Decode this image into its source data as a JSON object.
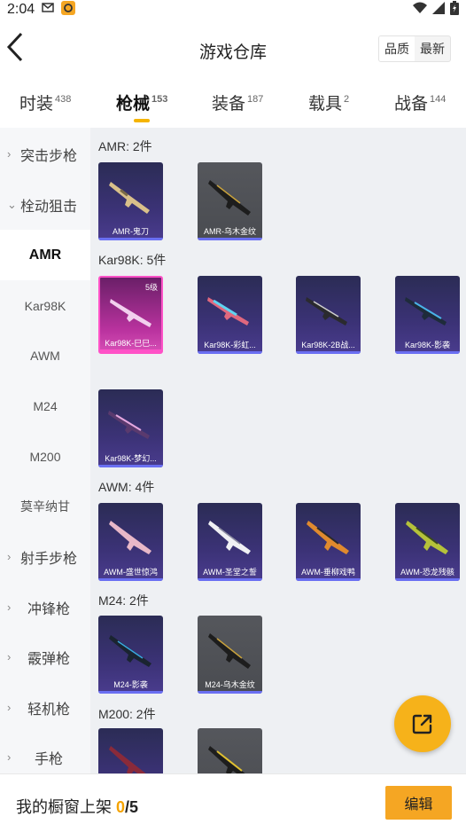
{
  "status_bar": {
    "time": "2:04",
    "icons": [
      "mail-icon",
      "app-notification-icon",
      "wifi-icon",
      "signal-icon",
      "battery-icon"
    ]
  },
  "header": {
    "title": "游戏仓库",
    "sort_options": [
      "品质",
      "最新"
    ],
    "active_sort": "品质"
  },
  "tabs": [
    {
      "label": "时装",
      "count": "438"
    },
    {
      "label": "枪械",
      "count": "153"
    },
    {
      "label": "装备",
      "count": "187"
    },
    {
      "label": "载具",
      "count": "2"
    },
    {
      "label": "战备",
      "count": "144"
    }
  ],
  "active_tab": "枪械",
  "sidebar": {
    "items": [
      {
        "label": "突击步枪",
        "type": "category",
        "expanded": false
      },
      {
        "label": "栓动狙击",
        "type": "category",
        "expanded": true
      },
      {
        "label": "AMR",
        "type": "sub",
        "active": true
      },
      {
        "label": "Kar98K",
        "type": "sub"
      },
      {
        "label": "AWM",
        "type": "sub"
      },
      {
        "label": "M24",
        "type": "sub"
      },
      {
        "label": "M200",
        "type": "sub"
      },
      {
        "label": "莫辛纳甘",
        "type": "sub"
      },
      {
        "label": "射手步枪",
        "type": "category",
        "expanded": false
      },
      {
        "label": "冲锋枪",
        "type": "category",
        "expanded": false
      },
      {
        "label": "霰弹枪",
        "type": "category",
        "expanded": false
      },
      {
        "label": "轻机枪",
        "type": "category",
        "expanded": false
      },
      {
        "label": "手枪",
        "type": "category",
        "expanded": false
      }
    ]
  },
  "groups": [
    {
      "title": "AMR: 2件",
      "items": [
        {
          "name": "AMR-鬼刀",
          "style": "purple"
        },
        {
          "name": "AMR-乌木金纹",
          "style": "gray"
        }
      ]
    },
    {
      "title": "Kar98K: 5件",
      "items": [
        {
          "name": "Kar98K-巳巳...",
          "style": "pink",
          "badge": "5级"
        },
        {
          "name": "Kar98K-彩虹...",
          "style": "purple"
        },
        {
          "name": "Kar98K-2B战...",
          "style": "purple"
        },
        {
          "name": "Kar98K-影袭",
          "style": "purple"
        },
        {
          "name": "Kar98K-梦幻...",
          "style": "purple"
        }
      ]
    },
    {
      "title": "AWM: 4件",
      "items": [
        {
          "name": "AWM-盛世惊鸿",
          "style": "purple"
        },
        {
          "name": "AWM-圣堂之誓",
          "style": "purple"
        },
        {
          "name": "AWM-垂柳戏鸭",
          "style": "purple"
        },
        {
          "name": "AWM-恐龙残骸",
          "style": "purple"
        }
      ]
    },
    {
      "title": "M24: 2件",
      "items": [
        {
          "name": "M24-影袭",
          "style": "purple"
        },
        {
          "name": "M24-乌木金纹",
          "style": "gray"
        }
      ]
    },
    {
      "title": "M200: 2件",
      "items": [
        {
          "name": "",
          "style": "purple"
        },
        {
          "name": "",
          "style": "gray"
        }
      ]
    }
  ],
  "bottom_bar": {
    "label": "我的橱窗上架",
    "count": "0",
    "total": "/5",
    "edit_label": "编辑"
  },
  "colors": {
    "accent": "#f5a623",
    "tab_underline": "#f5b400",
    "card_purple": "#3b3276",
    "card_gray": "#4a4c51",
    "card_pink": "#b9329e"
  }
}
